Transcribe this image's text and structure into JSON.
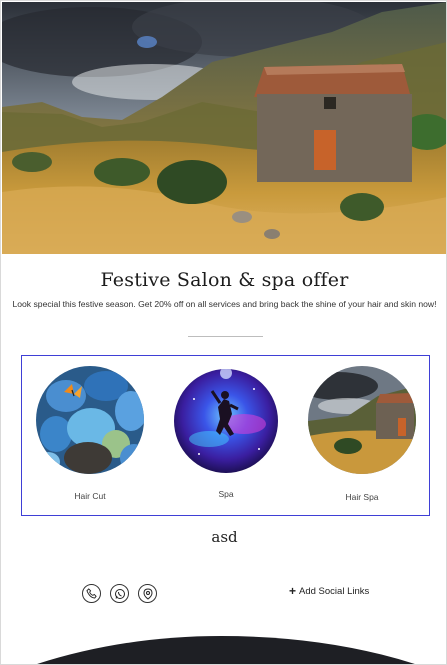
{
  "offer": {
    "title": "Festive Salon & spa offer",
    "description": "Look special this festive season. Get 20% off on all services and bring back the shine of your hair and skin now!"
  },
  "services": [
    {
      "label": "Hair Cut",
      "image": "pebbles-butterfly"
    },
    {
      "label": "Spa",
      "image": "cosmic-jumper"
    },
    {
      "label": "Hair Spa",
      "image": "stone-hut-landscape"
    }
  ],
  "footer_text": "asd",
  "contact_icons": [
    "phone-icon",
    "whatsapp-icon",
    "location-pin-icon"
  ],
  "social": {
    "label": "Add Social Links",
    "icon": "plus-icon"
  },
  "colors": {
    "accent_border": "#3f3fd6",
    "wave": "#1e1f24"
  }
}
